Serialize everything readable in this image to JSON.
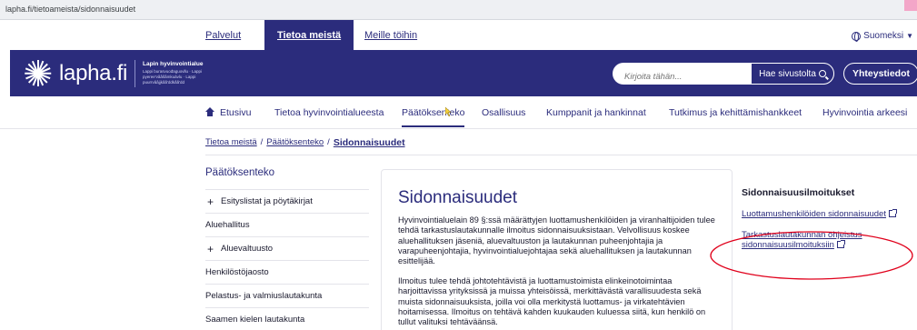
{
  "browser": {
    "url": "lapha.fi/tietoameista/sidonnaisuudet"
  },
  "topbar": {
    "tabs": [
      {
        "label": "Palvelut"
      },
      {
        "label": "Tietoa meistä"
      },
      {
        "label": "Meille töihin"
      }
    ],
    "language": "Suomeksi"
  },
  "header": {
    "logo_text": "lapha.fi",
    "logo_subtitle": "Lapin hyvinvointialue",
    "logo_subtitle_small": "Lappi burasvuođaguovllu · Lappi pyereeʹvââšâmkuávlu · Lappi puurrvââjjkååʹddkååʹdd",
    "search_placeholder": "Kirjoita tähän...",
    "search_button": "Hae sivustolta",
    "contact_button": "Yhteystiedot"
  },
  "mainnav": {
    "items": [
      {
        "label": "Etusivu"
      },
      {
        "label": "Tietoa hyvinvointialueesta"
      },
      {
        "label": "Päätöksenteko"
      },
      {
        "label": "Osallisuus"
      },
      {
        "label": "Kumppanit ja hankinnat"
      },
      {
        "label": "Tutkimus ja kehittämishankkeet"
      },
      {
        "label": "Hyvinvointia arkeesi"
      }
    ]
  },
  "breadcrumb": {
    "items": [
      "Tietoa meistä",
      "Päätöksenteko",
      "Sidonnaisuudet"
    ],
    "separator": "/"
  },
  "sidebar": {
    "heading": "Päätöksenteko",
    "items": [
      {
        "label": "Esityslistat ja pöytäkirjat",
        "prefix": "+"
      },
      {
        "label": "Aluehallitus",
        "prefix": ""
      },
      {
        "label": "Aluevaltuusto",
        "prefix": "+"
      },
      {
        "label": "Henkilöstöjaosto",
        "prefix": ""
      },
      {
        "label": "Pelastus- ja valmiuslautakunta",
        "prefix": ""
      },
      {
        "label": "Saamen kielen lautakunta",
        "prefix": ""
      }
    ]
  },
  "content": {
    "title": "Sidonnaisuudet",
    "paragraphs": [
      "Hyvinvointialuelain 89 §:ssä määrättyjen luottamushenkilöiden ja viranhaltijoiden tulee tehdä tarkastuslautakunnalle ilmoitus sidonnaisuuksistaan. Velvollisuus koskee aluehallituksen jäseniä, aluevaltuuston ja lautakunnan puheenjohtajia ja varapuheenjohtajia, hyvinvointialuejohtajaa sekä aluehallituksen ja lautakunnan esittelijää.",
      "Ilmoitus tulee tehdä johtotehtävistä ja luottamustoimista elinkeinotoimintaa harjoittavissa yrityksissä ja muissa yhteisöissä, merkittävästä varallisuudesta sekä muista sidonnaisuuksista, joilla voi olla merkitystä luottamus- ja virkatehtävien hoitamisessa. Ilmoitus on tehtävä kahden kuukauden kuluessa siitä, kun henkilö on tullut valituksi tehtäväänsä."
    ]
  },
  "aside": {
    "heading": "Sidonnaisuusilmoitukset",
    "links": [
      {
        "label": "Luottamushenkilöiden sidonnaisuudet"
      },
      {
        "label": "Tarkastuslautakunnan ohjeistus sidonnaisuusilmoituksiin"
      }
    ]
  },
  "colors": {
    "brand": "#2b2c7c",
    "annotation": "#e0001b"
  },
  "icons": [
    "globe-icon",
    "search-icon",
    "home-icon",
    "plus-icon",
    "external-link-icon",
    "cursor-icon"
  ]
}
